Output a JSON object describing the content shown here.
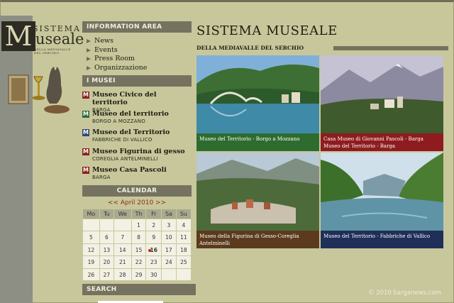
{
  "logo": {
    "line1": "SISTEMA",
    "letter": "M",
    "line2": "useale",
    "subline": "DELLA MEDIAVALLE DEL SERCHIO"
  },
  "sidebar": {
    "info_heading": "INFORMATION AREA",
    "info_items": [
      "News",
      "Events",
      "Press Room",
      "Organizzazione"
    ],
    "musei_heading": "I MUSEI",
    "musei": [
      {
        "title": "Museo Civico del territorio",
        "place": "BARGA",
        "icon": "museum-red-icon"
      },
      {
        "title": "Museo del territorio",
        "place": "BORGO A MOZZANO",
        "icon": "museum-green-icon"
      },
      {
        "title": "Museo del Territorio",
        "place": "FABBRICHE DI VALLICO",
        "icon": "museum-blue-icon"
      },
      {
        "title": "Museo Figurina di gesso",
        "place": "COREGLIA ANTELMINELLI",
        "icon": "museum-red-icon"
      },
      {
        "title": "Museo Casa Pascoli",
        "place": "BARGA",
        "icon": "museum-red-icon"
      }
    ],
    "calendar_heading": "CALENDAR",
    "calendar": {
      "prev": "<<",
      "month": "April 2010",
      "next": ">>",
      "weekdays": [
        "Mo",
        "Tu",
        "We",
        "Th",
        "Fr",
        "Sa",
        "Su"
      ],
      "weeks": [
        [
          "",
          "",
          "",
          "1",
          "2",
          "3",
          "4"
        ],
        [
          "5",
          "6",
          "7",
          "8",
          "9",
          "10",
          "11"
        ],
        [
          "12",
          "13",
          "14",
          "15",
          "16",
          "17",
          "18"
        ],
        [
          "19",
          "20",
          "21",
          "22",
          "23",
          "24",
          "25"
        ],
        [
          "26",
          "27",
          "28",
          "29",
          "30",
          "",
          ""
        ]
      ],
      "today": "16"
    },
    "search_heading": "SEARCH"
  },
  "main": {
    "title": "SISTEMA MUSEALE",
    "subtitle": "DELLA MEDIAVALLE DEL SERCHIO",
    "tiles": [
      {
        "caption": "Museo del Territorio - Borgo a Mozzano"
      },
      {
        "caption": "Casa Museo di Giovanni Pascoli - Barga\nMuseo del Territorio - Barga"
      },
      {
        "caption": "Museo della Figurina di Gesso-Coreglia\nAntelminelli"
      },
      {
        "caption": "Museo del Territorio - Fabbriche di Vallico"
      }
    ]
  },
  "copyright": "© 2010 barganews.com",
  "colors": {
    "background": "#c8c79c",
    "header_bar": "#75735f",
    "caption_green": "#2e6b2f",
    "caption_red": "#8e1c1e",
    "caption_brown": "#5b3a1d",
    "caption_blue": "#1f2f58"
  }
}
